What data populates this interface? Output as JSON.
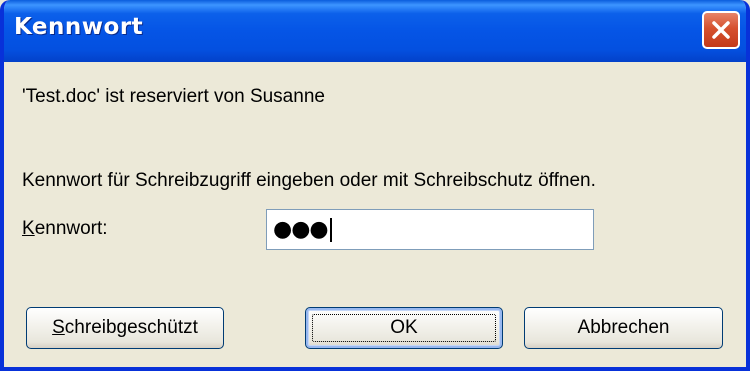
{
  "window": {
    "title": "Kennwort"
  },
  "message": {
    "reserved": "'Test.doc' ist reserviert von Susanne",
    "instruction": "Kennwort für Schreibzugriff eingeben oder mit Schreibschutz öffnen."
  },
  "password": {
    "label_accel": "K",
    "label_rest": "ennwort:",
    "value": "●●●"
  },
  "buttons": {
    "readonly_accel": "S",
    "readonly_rest": "chreibgeschützt",
    "ok": "OK",
    "cancel": "Abbrechen"
  },
  "colors": {
    "titlebar": "#0555e6",
    "window_bg": "#ece9d8",
    "close": "#d6512e"
  }
}
